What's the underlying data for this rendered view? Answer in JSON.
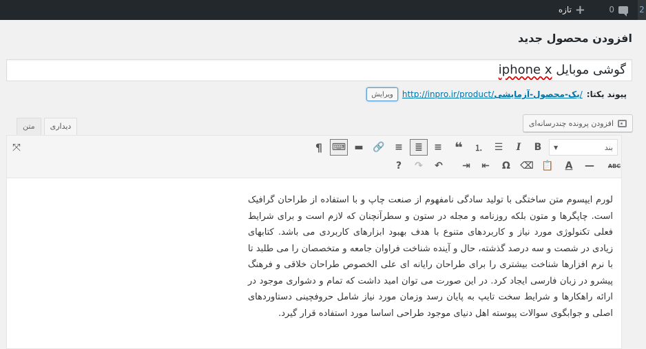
{
  "adminbar": {
    "corner_text": "2",
    "new_label": "تازه",
    "comments_count": "0"
  },
  "page": {
    "title": "افزودن محصول جدید"
  },
  "title_field": {
    "value_latin": "iphone x",
    "value_fa": " گوشی موبایل"
  },
  "permalink": {
    "label": "پیوند یکتا:",
    "url_base": "http://inpro.ir/product/",
    "url_slug": "یک-محصول-آزمایشی",
    "url_end": "/",
    "edit_label": "ویرایش"
  },
  "media": {
    "add_label": "افزودن پرونده چندرسانه‌ای"
  },
  "tabs": {
    "visual": "دیداری",
    "text": "متن"
  },
  "toolbar": {
    "format_value": "بند",
    "row1": [
      "bold-icon",
      "italic-icon",
      "bullet-list-icon",
      "numbered-list-icon",
      "blockquote-icon",
      "align-left-icon",
      "align-center-icon",
      "align-right-icon",
      "link-icon",
      "read-more-icon",
      "toolbar-toggle-icon",
      "paragraph-icon"
    ],
    "row2": [
      "strikethrough-icon",
      "horizontal-line-icon",
      "text-color-icon",
      "paste-text-icon",
      "clear-formatting-icon",
      "special-character-icon",
      "outdent-icon",
      "indent-icon",
      "undo-icon",
      "redo-icon",
      "help-icon"
    ]
  },
  "content": {
    "body": "لورم ایپسوم متن ساختگی با تولید سادگی نامفهوم از صنعت چاپ و با استفاده از طراحان گرافیک است. چاپگرها و متون بلکه روزنامه و مجله در ستون و سطرآنچنان که لازم است و برای شرایط فعلی تکنولوژی مورد نیاز و کاربردهای متنوع با هدف بهبود ابزارهای کاربردی می باشد. کتابهای زیادی در شصت و سه درصد گذشته، حال و آینده شناخت فراوان جامعه و متخصصان را می طلبد تا با نرم افزارها شناخت بیشتری را برای طراحان رایانه ای علی الخصوص طراحان خلاقی و فرهنگ پیشرو در زبان فارسی ایجاد کرد. در این صورت می توان امید داشت که تمام و دشواری موجود در ارائه راهکارها و شرایط سخت تایپ به پایان رسد وزمان مورد نیاز شامل حروفچینی دستاوردهای اصلی و جوابگوی سوالات پیوسته اهل دنیای موجود طراحی اساسا مورد استفاده قرار گیرد."
  }
}
